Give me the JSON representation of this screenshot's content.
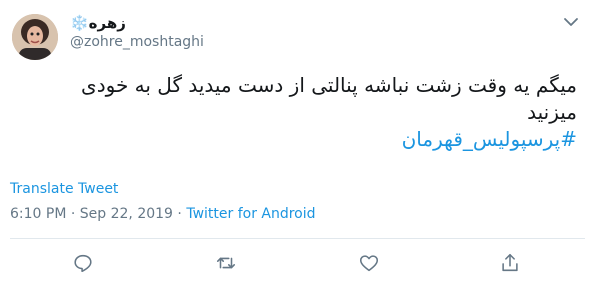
{
  "user": {
    "display_name": "زهره❄️",
    "handle": "@zohre_moshtaghi"
  },
  "tweet": {
    "line1": "میگم یه وقت زشت نباشه پنالتی از دست میدید گل به خودی",
    "line2": "میزنید",
    "hashtag": "#پرسپولیس_قهرمان"
  },
  "translate_label": "Translate Tweet",
  "meta": {
    "time": "6:10 PM",
    "separator1": "·",
    "date": "Sep 22, 2019",
    "separator2": "·",
    "via": "Twitter for Android"
  },
  "icons": {
    "reply": "reply-icon",
    "retweet": "retweet-icon",
    "like": "heart-icon",
    "share": "share-icon",
    "more": "chevron-down-icon"
  },
  "colors": {
    "link": "#1b95e0",
    "muted": "#657786",
    "text": "#14171a"
  }
}
